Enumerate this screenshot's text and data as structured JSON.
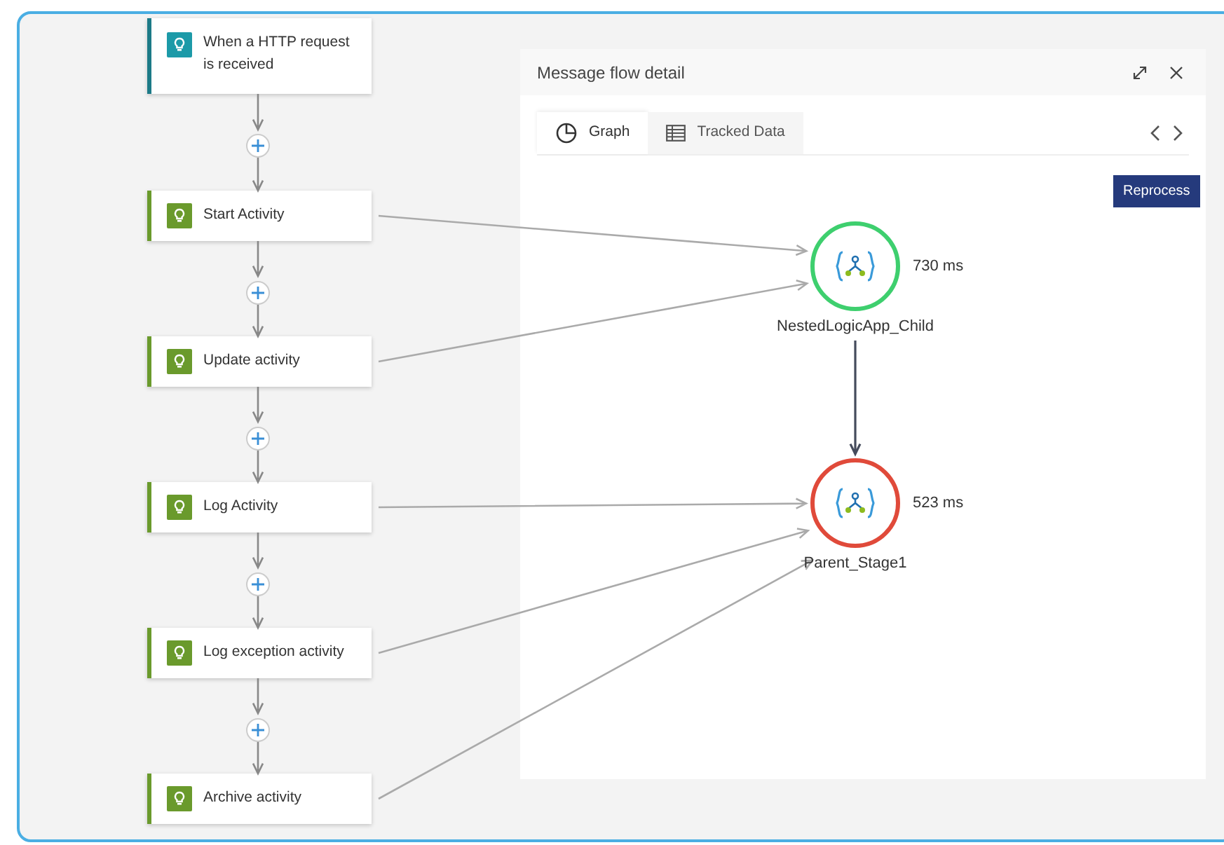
{
  "steps": [
    {
      "kind": "trigger",
      "label": "When a HTTP request is received"
    },
    {
      "kind": "action",
      "label": "Start Activity"
    },
    {
      "kind": "action",
      "label": "Update activity"
    },
    {
      "kind": "action",
      "label": "Log Activity"
    },
    {
      "kind": "action",
      "label": "Log exception activity"
    },
    {
      "kind": "action",
      "label": "Archive activity"
    }
  ],
  "panel": {
    "title": "Message flow detail",
    "tabs": [
      {
        "kind": "graph",
        "label": "Graph",
        "selected": true
      },
      {
        "kind": "table",
        "label": "Tracked Data",
        "selected": false
      }
    ],
    "reprocess_button": "Reprocess",
    "nodes": [
      {
        "name": "NestedLogicApp_Child",
        "duration": "730 ms",
        "color": "#3ecf6e"
      },
      {
        "name": "Parent_Stage1",
        "duration": "523 ms",
        "color": "#e04a3a"
      }
    ]
  }
}
